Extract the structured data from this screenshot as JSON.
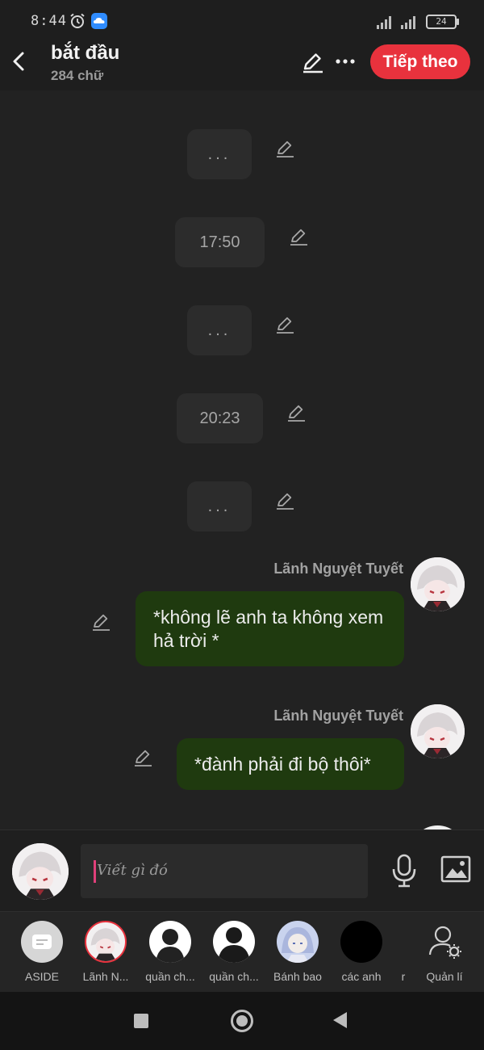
{
  "status": {
    "time": "8:44",
    "battery": "24"
  },
  "header": {
    "title": "bắt đầu",
    "word_count": "284 chữ",
    "next_label": "Tiếp theo"
  },
  "chat": {
    "system_messages": [
      "...",
      "17:50",
      "...",
      "20:23",
      "..."
    ],
    "messages": [
      {
        "sender": "Lãnh Nguyệt Tuyết",
        "text": "*không lẽ anh ta không xem hả trời *"
      },
      {
        "sender": "Lãnh Nguyệt Tuyết",
        "text": "*đành phải đi bộ thôi*"
      }
    ]
  },
  "input": {
    "placeholder": "Viết gì đó"
  },
  "characters": [
    {
      "label": "ASIDE",
      "icon": "aside-icon"
    },
    {
      "label": "Lãnh N..."
    },
    {
      "label": "quần ch..."
    },
    {
      "label": "quần ch..."
    },
    {
      "label": "Bánh bao"
    },
    {
      "label": "các anh"
    },
    {
      "label": "r"
    },
    {
      "label": "Quản lí",
      "icon": "manage-users-icon"
    }
  ],
  "colors": {
    "accent": "#e8323d",
    "bubble": "#1f3a0f",
    "background": "#222222"
  }
}
